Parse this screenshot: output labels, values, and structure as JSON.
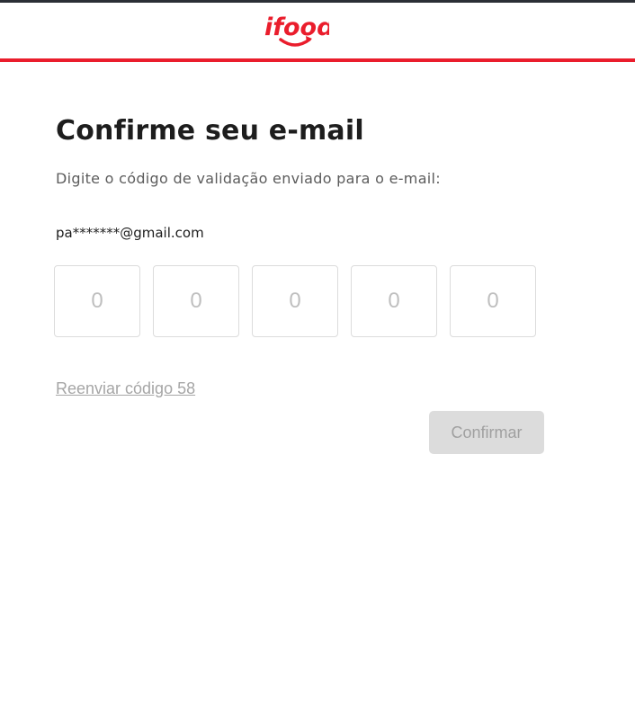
{
  "brand": {
    "logo_text": "ifood",
    "accent_color": "#ea1d2c",
    "logo-icon": "ifood-logo"
  },
  "page": {
    "title": "Confirme seu e-mail",
    "subtitle": "Digite o código de validação enviado para o e-mail:",
    "email": "pa*******@gmail.com"
  },
  "code_inputs": [
    {
      "value": "",
      "placeholder": "0"
    },
    {
      "value": "",
      "placeholder": "0"
    },
    {
      "value": "",
      "placeholder": "0"
    },
    {
      "value": "",
      "placeholder": "0"
    },
    {
      "value": "",
      "placeholder": "0"
    }
  ],
  "actions": {
    "resend_label": "Reenviar código 58",
    "confirm_label": "Confirmar",
    "confirm_disabled": true
  }
}
